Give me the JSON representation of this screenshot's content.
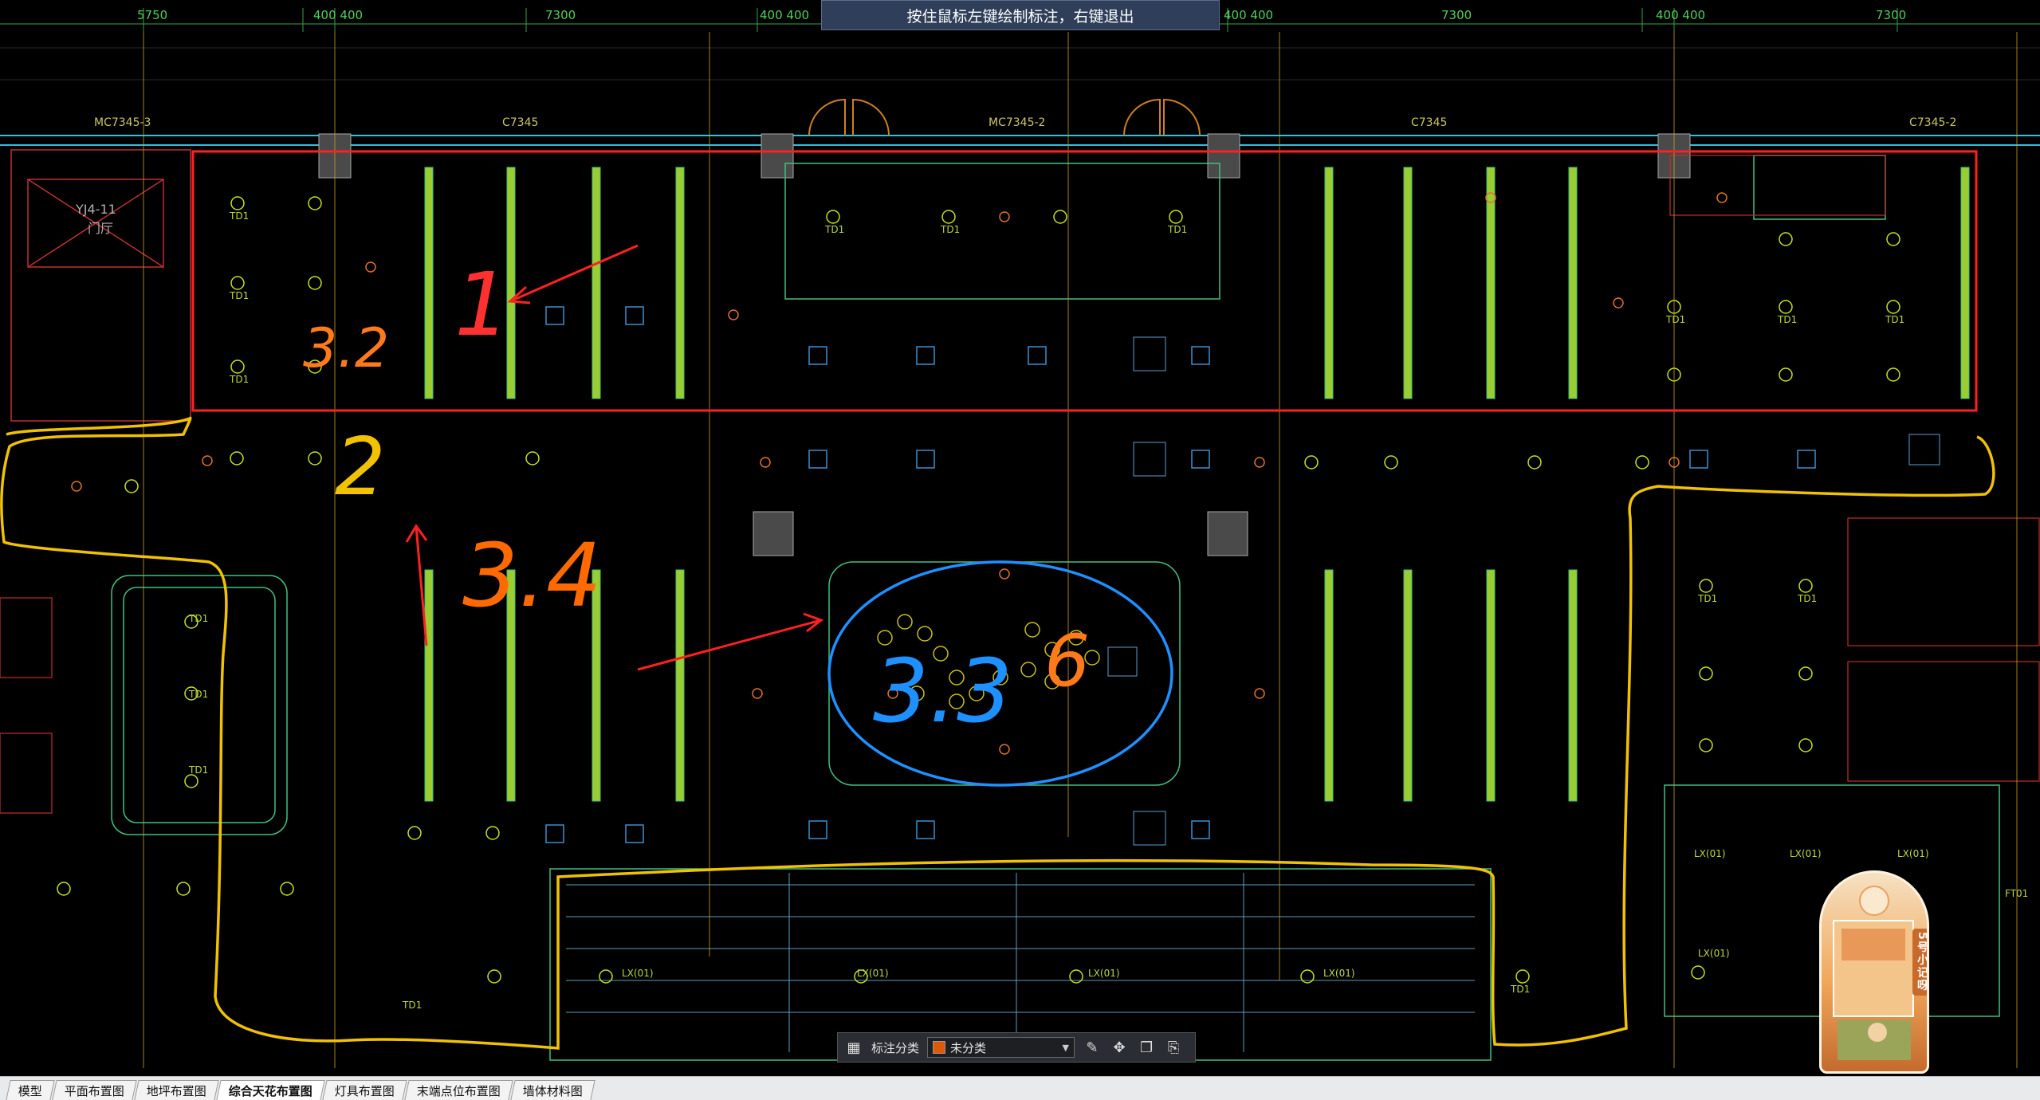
{
  "hint": {
    "text": "按住鼠标左键绘制标注，右键退出"
  },
  "dimensions": {
    "d1": "5750",
    "d2": "400 400",
    "d3": "7300",
    "d4": "400 400",
    "d5": "400 400",
    "d6": "7300",
    "d7": "400 400",
    "d8": "7300"
  },
  "window_tags": {
    "w1": "MC7345-3",
    "w2": "C7345",
    "w3": "MC7345-2",
    "w4": "C7345",
    "w5": "C7345-2"
  },
  "room_tag": {
    "line1": "YJ4-11",
    "line2": "门厅"
  },
  "fixture_label": "TD1",
  "fixture_label_lx": "LX(01)",
  "fixture_label_ft": "FT01",
  "annotations": {
    "a1": "3.2",
    "a2": "1",
    "a3": "2",
    "a4": "3.4",
    "a5": "3.3",
    "a6": "6"
  },
  "annotation_toolbar": {
    "category_label": "标注分类",
    "category_value": "未分类",
    "category_color": "#e0580a"
  },
  "tabs": [
    {
      "label": "模型"
    },
    {
      "label": "平面布置图"
    },
    {
      "label": "地坪布置图"
    },
    {
      "label": "综合天花布置图",
      "active": true
    },
    {
      "label": "灯具布置图"
    },
    {
      "label": "末端点位布置图"
    },
    {
      "label": "墙体材料图"
    }
  ],
  "sticker": {
    "text": "5号小记呀"
  },
  "colors": {
    "red_markup": "#ff2020",
    "yellow_markup": "#f2c200",
    "blue_markup": "#1e90ff",
    "orange_markup": "#ff6a00"
  }
}
